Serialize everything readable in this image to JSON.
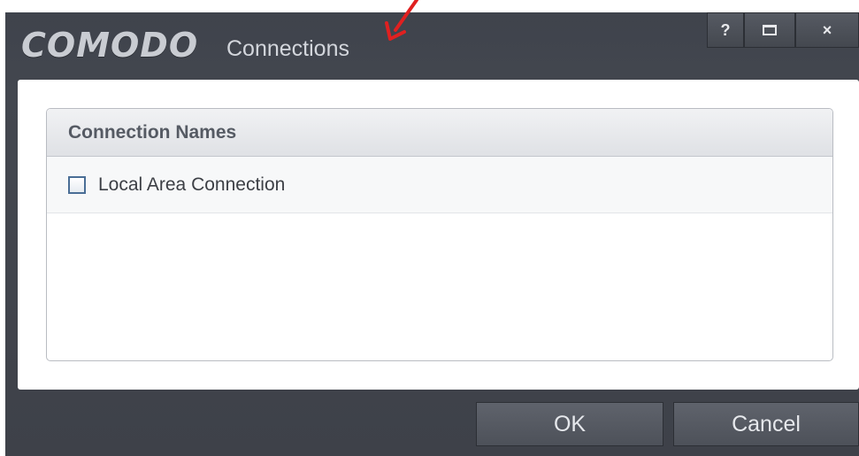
{
  "window": {
    "brand": "COMODO",
    "title": "Connections",
    "controls": {
      "help_label": "?",
      "maximize_icon": "maximize-icon",
      "close_label": "×"
    }
  },
  "list": {
    "header": "Connection Names",
    "items": [
      {
        "label": "Local Area Connection",
        "checked": false
      }
    ]
  },
  "buttons": {
    "ok_label": "OK",
    "cancel_label": "Cancel"
  },
  "colors": {
    "window_bg": "#43474f",
    "content_bg": "#ffffff",
    "checkbox_border": "#4a6e96",
    "annotation_arrow": "#e02020"
  }
}
